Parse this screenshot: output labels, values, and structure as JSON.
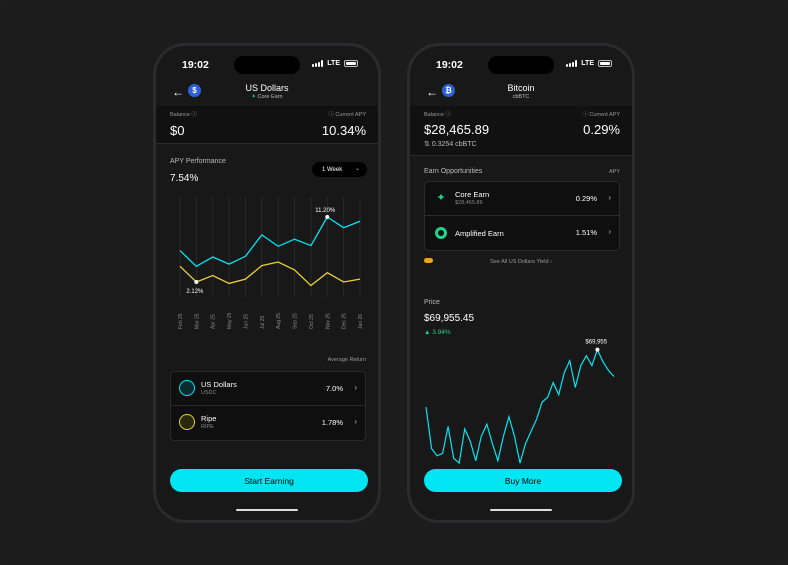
{
  "left_phone": {
    "status": {
      "time": "19:02",
      "network": "LTE"
    },
    "header": {
      "title": "US Dollars",
      "subtitle": "Core Earn",
      "coin_symbol": "$"
    },
    "balance": {
      "label": "Balance",
      "value": "$0"
    },
    "apy": {
      "label": "Current APY",
      "value": "10.34%"
    },
    "performance": {
      "title": "APY Performance",
      "value": "7.54%",
      "range": "1 Week"
    },
    "x_labels": [
      "Feb 25",
      "Mar 25",
      "Apr 25",
      "May 25",
      "Jun 25",
      "Jul 25",
      "Aug 25",
      "Sep 25",
      "Oct 25",
      "Nov 25",
      "Dec 25",
      "Jan 26"
    ],
    "annotations": {
      "high": "11.20%",
      "low": "2.12%"
    },
    "avg_return_label": "Average Return",
    "assets": [
      {
        "name": "US Dollars",
        "ticker": "USDC",
        "value": "7.0%"
      },
      {
        "name": "Ripe",
        "ticker": "RIPE",
        "value": "1.78%"
      }
    ],
    "cta": "Start Earning"
  },
  "right_phone": {
    "status": {
      "time": "19:02",
      "network": "LTE"
    },
    "header": {
      "title": "Bitcoin",
      "subtitle": "cbBTC",
      "coin_symbol": "₿"
    },
    "balance": {
      "label": "Balance",
      "value": "$28,465.89",
      "sub": "0.3254 cbBTC"
    },
    "apy": {
      "label": "Current APY",
      "value": "0.29%"
    },
    "earn": {
      "title": "Earn Opportunities",
      "right_label": "APY",
      "items": [
        {
          "name": "Core Earn",
          "sub": "$28,465.89",
          "value": "0.29%"
        },
        {
          "name": "Amplified Earn",
          "sub": "",
          "value": "1.51%"
        }
      ],
      "link": "See All US Dollars Yield"
    },
    "price": {
      "label": "Price",
      "value": "$69,955.45",
      "change": "▲ 3.94%",
      "peak_label": "$69,955"
    },
    "cta": "Buy More"
  },
  "colors": {
    "accent": "#00e5f2",
    "yellow": "#e8d13a",
    "green": "#22d28f",
    "bg": "#181818"
  },
  "chart_data": [
    {
      "type": "line",
      "title": "APY Performance",
      "categories": [
        "Feb 25",
        "Mar 25",
        "Apr 25",
        "May 25",
        "Jun 25",
        "Jul 25",
        "Aug 25",
        "Sep 25",
        "Oct 25",
        "Nov 25",
        "Dec 25",
        "Jan 26"
      ],
      "series": [
        {
          "values": [
            6.5,
            4.3,
            5.6,
            4.6,
            5.7,
            8.7,
            7.1,
            8.1,
            7.2,
            11.2,
            9.7,
            10.6
          ]
        },
        {
          "values": [
            4.3,
            2.1,
            3.0,
            1.9,
            2.5,
            4.4,
            4.9,
            3.8,
            1.6,
            3.4,
            2.1,
            2.5
          ]
        }
      ],
      "annotations": [
        "11.20%",
        "2.12%"
      ],
      "ylim": [
        0,
        14
      ]
    },
    {
      "type": "line",
      "title": "Price",
      "series": [
        {
          "values": [
            50,
            16,
            10,
            12,
            34,
            8,
            4,
            32,
            22,
            6,
            26,
            36,
            20,
            6,
            26,
            42,
            26,
            4,
            20,
            30,
            40,
            54,
            58,
            70,
            60,
            78,
            88,
            66,
            84,
            92,
            84,
            97,
            87,
            80,
            75
          ]
        }
      ],
      "annotations": [
        "$69,955"
      ]
    }
  ]
}
